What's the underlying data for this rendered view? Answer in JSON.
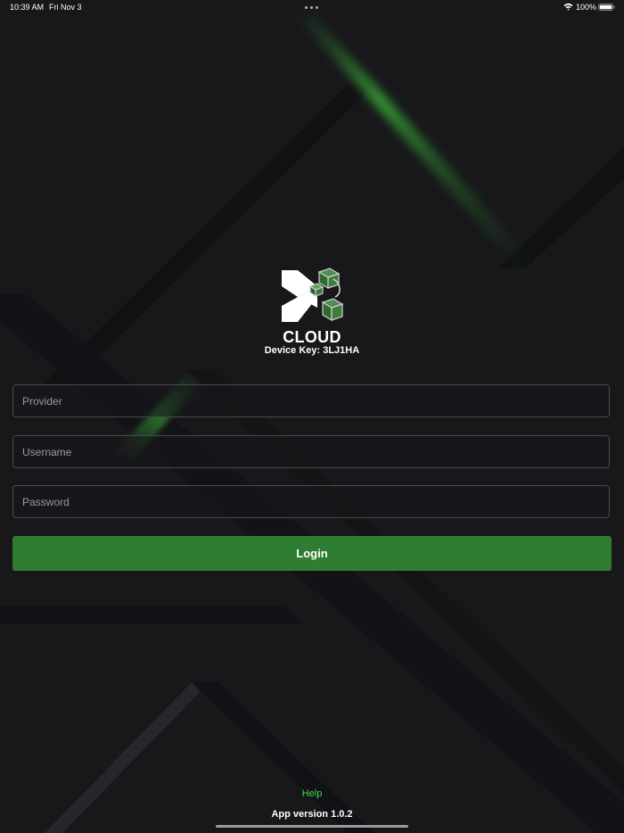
{
  "status_bar": {
    "time": "10:39 AM",
    "date": "Fri Nov 3",
    "battery_percent": "100%",
    "wifi_icon": "wifi-icon",
    "battery_icon": "battery-icon",
    "battery_level": 1.0
  },
  "brand": {
    "logo_icon": "cloud-play-logo-icon",
    "name": "CLOUD",
    "device_key_text": "Device Key: 3LJ1HA"
  },
  "form": {
    "provider": {
      "value": "",
      "placeholder": "Provider"
    },
    "username": {
      "value": "",
      "placeholder": "Username"
    },
    "password": {
      "value": "",
      "placeholder": "Password"
    },
    "login_label": "Login"
  },
  "footer": {
    "help_label": "Help",
    "app_version": "App version 1.0.2"
  },
  "colors": {
    "background": "#18181b",
    "accent": "#2e7d32",
    "link": "#3ddc3d",
    "field_border": "#4a4a4e"
  }
}
